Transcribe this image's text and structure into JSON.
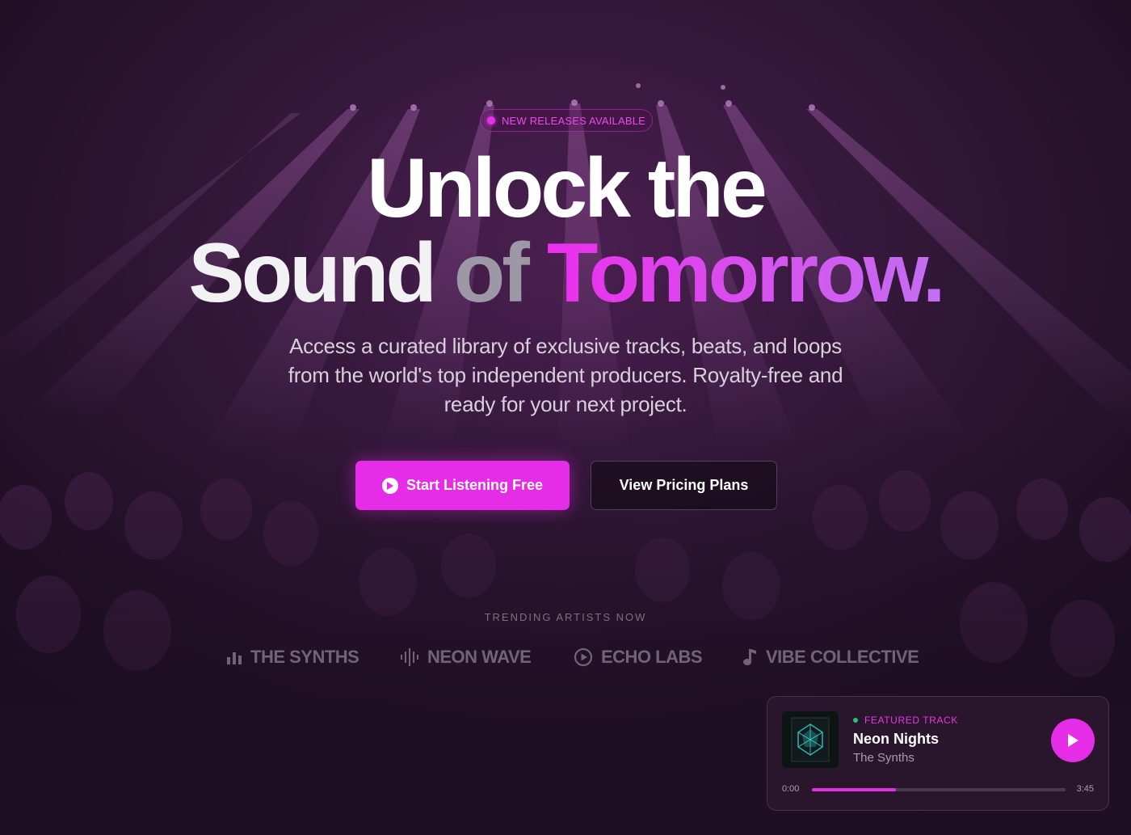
{
  "badge": {
    "text": "NEW RELEASES AVAILABLE"
  },
  "hero": {
    "line1": "Unlock the",
    "line2_part1": "Sound",
    "line2_part2": "of",
    "line2_accent": "Tomorrow.",
    "subtitle": "Access a curated library of exclusive tracks, beats, and loops from the world's top independent producers. Royalty-free and ready for your next project."
  },
  "cta": {
    "primary_label": "Start Listening Free",
    "secondary_label": "View Pricing Plans"
  },
  "trending": {
    "label": "TRENDING ARTISTS NOW",
    "artists": [
      {
        "name": "THE SYNTHS",
        "icon": "bar-chart-icon"
      },
      {
        "name": "NEON WAVE",
        "icon": "waveform-icon"
      },
      {
        "name": "ECHO LABS",
        "icon": "play-circle-icon"
      },
      {
        "name": "VIBE COLLECTIVE",
        "icon": "music-note-icon"
      }
    ]
  },
  "player": {
    "label": "FEATURED TRACK",
    "title": "Neon Nights",
    "artist": "The Synths",
    "time_current": "0:00",
    "time_total": "3:45",
    "progress": 0.33
  },
  "colors": {
    "accent": "#e52ce6",
    "background": "#1e0f24",
    "live": "#27c46a"
  }
}
